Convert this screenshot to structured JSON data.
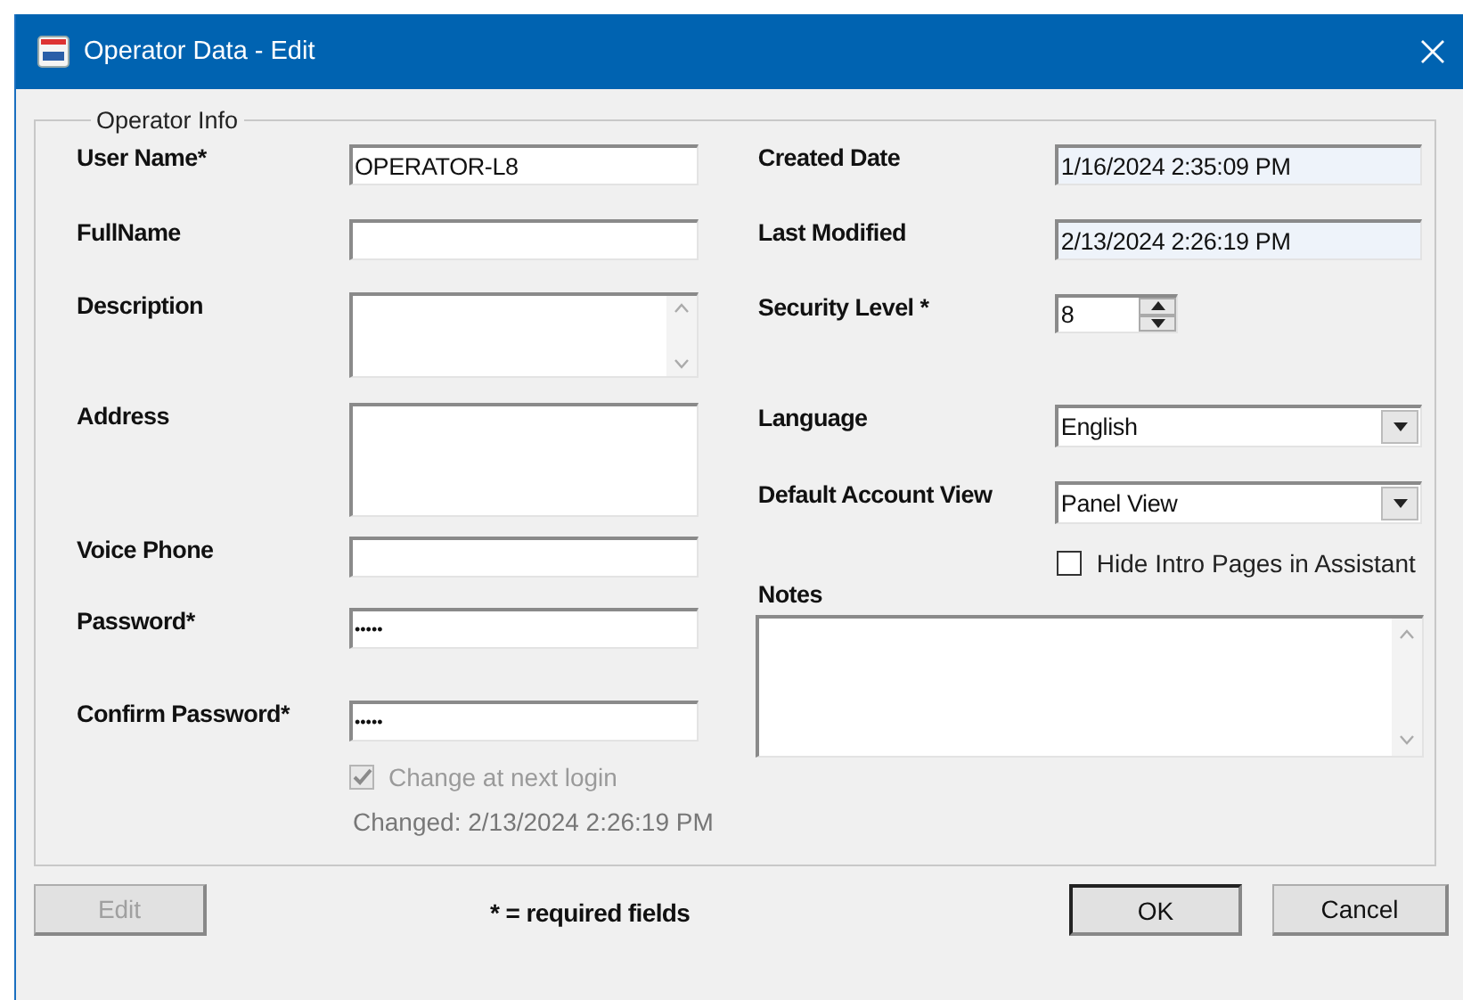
{
  "window": {
    "title": "Operator Data - Edit"
  },
  "group": {
    "title": "Operator Info"
  },
  "left_fields": [
    {
      "label": "User Name*",
      "kind": "text",
      "value": "OPERATOR-L8"
    },
    {
      "label": "FullName",
      "kind": "text"
    },
    {
      "label": "Description",
      "kind": "memo"
    },
    {
      "label": "Address",
      "kind": "area"
    },
    {
      "label": "Voice Phone",
      "kind": "text"
    },
    {
      "label": "Password*",
      "kind": "password",
      "value": "•••••"
    },
    {
      "label": "Confirm Password*",
      "kind": "password",
      "value": "•••••"
    }
  ],
  "change_login": {
    "label": "Change at next login",
    "checked": true,
    "disabled": true
  },
  "changed_text": "Changed: 2/13/2024 2:26:19 PM",
  "right_fields": [
    {
      "label": "Created Date",
      "kind": "readonly",
      "value": "1/16/2024 2:35:09 PM"
    },
    {
      "label": "Last Modified",
      "kind": "readonly",
      "value": "2/13/2024 2:26:19 PM"
    },
    {
      "label": "Security Level *",
      "kind": "spin",
      "value": "8"
    },
    {
      "label": "Language",
      "kind": "dropdown",
      "value": "English"
    },
    {
      "label": "Default Account View",
      "kind": "dropdown",
      "value": "Panel View"
    }
  ],
  "hide_intro": {
    "label": "Hide Intro Pages in Assistant",
    "checked": false,
    "disabled": false
  },
  "notes": {
    "label": "Notes"
  },
  "footer": {
    "edit_button": {
      "label": "Edit",
      "disabled": true
    },
    "note": "* = required fields",
    "ok_button": {
      "label": "OK",
      "default": true
    },
    "cancel_button": {
      "label": "Cancel",
      "default": false
    }
  }
}
